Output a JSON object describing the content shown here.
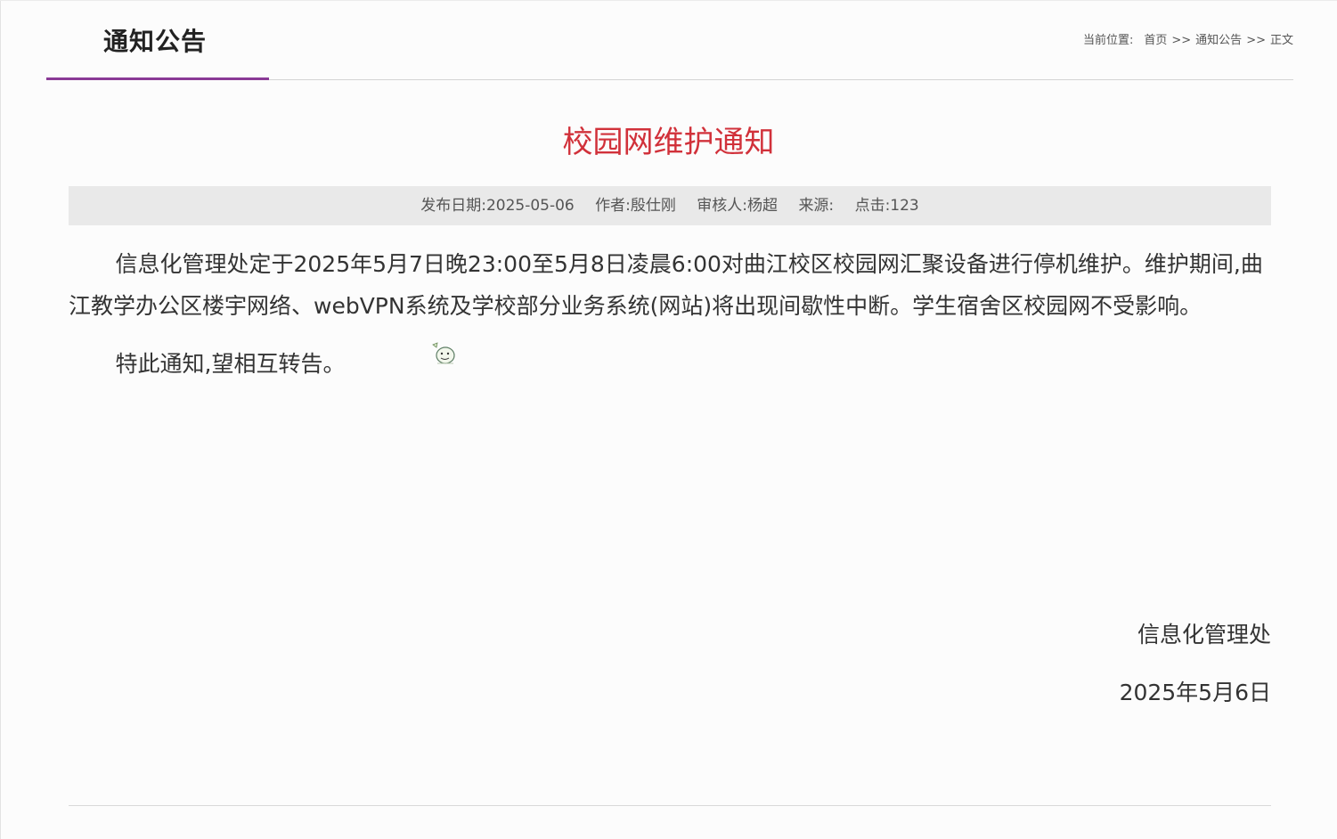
{
  "header": {
    "section_title": "通知公告",
    "accent_color": "#8a3a96"
  },
  "breadcrumb": {
    "label": "当前位置:",
    "items": [
      "首页",
      "通知公告",
      "正文"
    ],
    "separator": ">>"
  },
  "article": {
    "title": "校园网维护通知",
    "title_color": "#d1313a",
    "meta": {
      "publish_date": "发布日期:2025-05-06",
      "author": "作者:殷仕刚",
      "reviewer": "审核人:杨超",
      "source": "来源:",
      "clicks": "点击:123"
    },
    "paragraphs": [
      "信息化管理处定于2025年5月7日晚23:00至5月8日凌晨6:00对曲江校区校园网汇聚设备进行停机维护。维护期间,曲江教学办公区楼宇网络、webVPN系统及学校部分业务系统(网站)将出现间歇性中断。学生宿舍区校园网不受影响。",
      "特此通知,望相互转告。"
    ],
    "signature": {
      "department": "信息化管理处",
      "date": "2025年5月6日"
    }
  },
  "icons": {
    "emoticon": "emoticon-icon"
  }
}
